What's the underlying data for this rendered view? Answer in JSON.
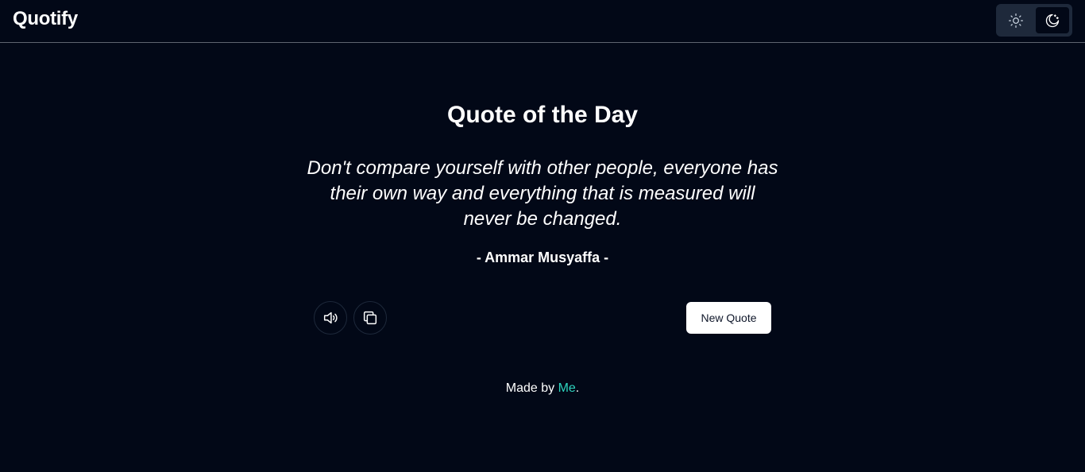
{
  "header": {
    "brand": "Quotify",
    "theme_toggle": {
      "light_icon": "sun-icon",
      "dark_icon": "moon-icon",
      "selected": "dark"
    }
  },
  "main": {
    "title": "Quote of the Day",
    "quote": "Don't compare yourself with other people, everyone has their own way and everything that is measured will never be changed.",
    "author": "- Ammar Musyaffa -",
    "actions": {
      "speak_icon": "speaker-icon",
      "copy_icon": "copy-icon",
      "new_quote_label": "New Quote"
    }
  },
  "footer": {
    "prefix": "Made by ",
    "link_text": "Me",
    "suffix": "."
  },
  "colors": {
    "background": "#020817",
    "accent_link": "#2dd4bf",
    "toggle_bg": "#1e293b",
    "button_bg": "#ffffff"
  }
}
